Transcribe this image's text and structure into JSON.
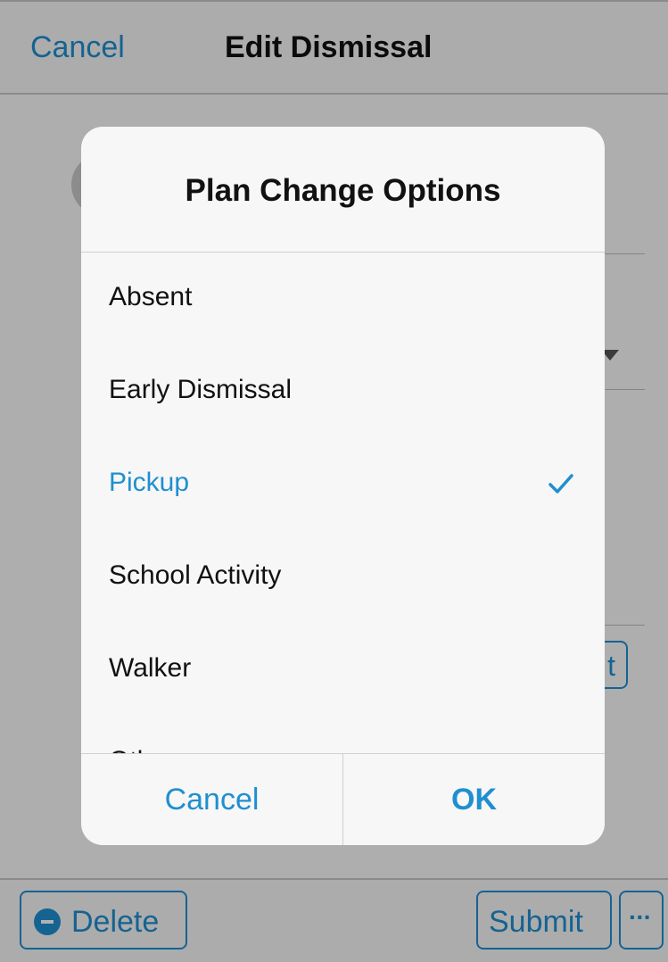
{
  "navbar": {
    "cancel_label": "Cancel",
    "title": "Edit Dismissal"
  },
  "background": {
    "right_button_fragment": "t"
  },
  "toolbar": {
    "delete_label": "Delete",
    "submit_label": "Submit",
    "more_label": "···"
  },
  "dialog": {
    "title": "Plan Change Options",
    "options": [
      {
        "label": "Absent",
        "selected": false
      },
      {
        "label": "Early Dismissal",
        "selected": false
      },
      {
        "label": "Pickup",
        "selected": true
      },
      {
        "label": "School Activity",
        "selected": false
      },
      {
        "label": "Walker",
        "selected": false
      },
      {
        "label": "Other",
        "selected": false
      }
    ],
    "cancel_label": "Cancel",
    "ok_label": "OK"
  },
  "colors": {
    "accent": "#1f8fd0"
  },
  "icons": {
    "selected_marker": "checkmark-icon",
    "delete": "minus-circle-icon"
  }
}
